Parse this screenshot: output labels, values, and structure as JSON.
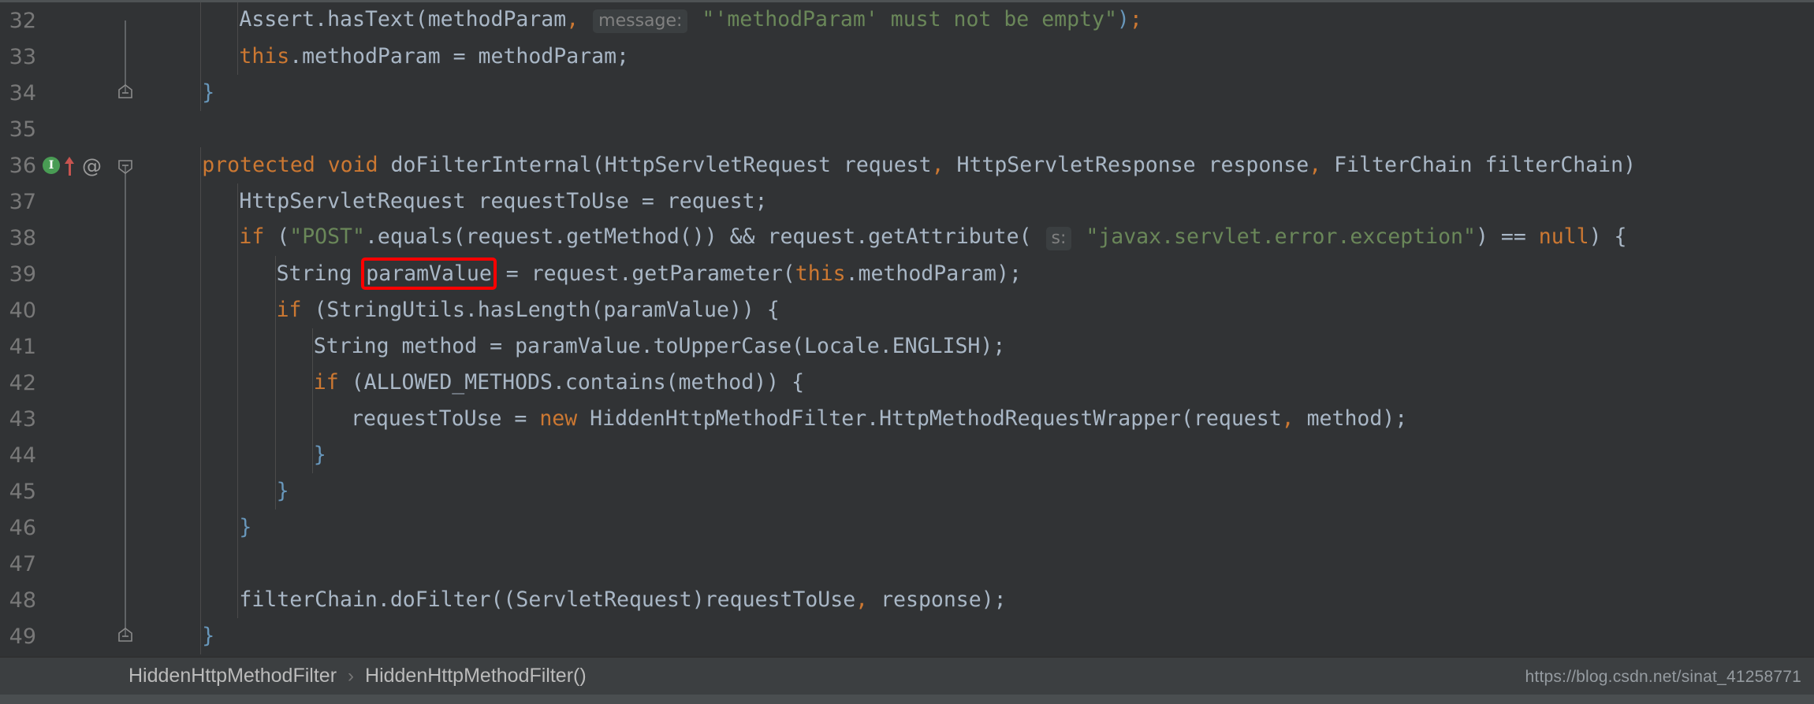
{
  "window": {
    "app": "IntelliJ IDEA",
    "theme": "Darcula"
  },
  "colors": {
    "editor_bg": "#313335",
    "gutter_bg": "#313335",
    "line_number": "#787878",
    "default_text": "#a9b7c6",
    "keyword": "#cc7832",
    "string": "#6a8759",
    "number": "#6897bb",
    "hint_bg": "#3b3f41",
    "hint_text": "#808080",
    "annotation_box": "#ff0000",
    "implements_marker": "#499c54",
    "override_arrow": "#c75450",
    "breadcrumb_bg": "#3c3f41",
    "breadcrumb_text": "#bbbbbb"
  },
  "gutter": {
    "markers": {
      "implements_icon_label": "I",
      "override_icon": "override-arrow-icon",
      "annotation_icon": "@"
    }
  },
  "code": {
    "language": "java",
    "lines": [
      {
        "number": "32",
        "indent": 2,
        "tokens": [
          {
            "text": "Assert",
            "cls": "t-txt"
          },
          {
            "text": ".hasText(",
            "cls": "t-txt"
          },
          {
            "text": "methodParam",
            "cls": "t-txt"
          },
          {
            "text": ",",
            "cls": "t-punc"
          },
          {
            "text": " ",
            "cls": "t-txt"
          },
          {
            "text": "message:",
            "cls": "phint"
          },
          {
            "text": " ",
            "cls": "t-txt"
          },
          {
            "text": "\"'methodParam' must not be empty\"",
            "cls": "t-str"
          },
          {
            "text": ")",
            "cls": "t-num"
          },
          {
            "text": ";",
            "cls": "t-punc"
          }
        ]
      },
      {
        "number": "33",
        "indent": 2,
        "tokens": [
          {
            "text": "this",
            "cls": "t-kw"
          },
          {
            "text": ".methodParam = methodParam;",
            "cls": "t-txt"
          }
        ]
      },
      {
        "number": "34",
        "indent": 1,
        "fold": "end",
        "tokens": [
          {
            "text": "}",
            "cls": "t-num"
          }
        ]
      },
      {
        "number": "35",
        "indent": 0,
        "tokens": []
      },
      {
        "number": "36",
        "indent": 1,
        "fold": "start",
        "markers": [
          "implements",
          "override",
          "annotation"
        ],
        "tokens": [
          {
            "text": "protected void ",
            "cls": "t-kw"
          },
          {
            "text": "doFilterInternal(HttpServletRequest request",
            "cls": "t-txt"
          },
          {
            "text": ",",
            "cls": "t-punc"
          },
          {
            "text": " HttpServletResponse response",
            "cls": "t-txt"
          },
          {
            "text": ",",
            "cls": "t-punc"
          },
          {
            "text": " FilterChain filterChain)",
            "cls": "t-txt"
          }
        ]
      },
      {
        "number": "37",
        "indent": 2,
        "tokens": [
          {
            "text": "HttpServletRequest requestToUse = request;",
            "cls": "t-txt"
          }
        ]
      },
      {
        "number": "38",
        "indent": 2,
        "fold": "start",
        "tokens": [
          {
            "text": "if",
            "cls": "t-kw"
          },
          {
            "text": " (",
            "cls": "t-txt"
          },
          {
            "text": "\"POST\"",
            "cls": "t-str"
          },
          {
            "text": ".equals(request.getMethod()) && request.getAttribute( ",
            "cls": "t-txt"
          },
          {
            "text": "s:",
            "cls": "phint"
          },
          {
            "text": " ",
            "cls": "t-txt"
          },
          {
            "text": "\"javax.servlet.error.exception\"",
            "cls": "t-str"
          },
          {
            "text": ") == ",
            "cls": "t-txt"
          },
          {
            "text": "null",
            "cls": "t-kw"
          },
          {
            "text": ") {",
            "cls": "t-txt"
          }
        ]
      },
      {
        "number": "39",
        "indent": 3,
        "tokens": [
          {
            "text": "String ",
            "cls": "t-txt"
          },
          {
            "text": "paramValue",
            "cls": "t-txt",
            "box": true
          },
          {
            "text": " = request.getParameter(",
            "cls": "t-txt"
          },
          {
            "text": "this",
            "cls": "t-kw"
          },
          {
            "text": ".methodParam);",
            "cls": "t-txt"
          }
        ]
      },
      {
        "number": "40",
        "indent": 3,
        "fold": "start",
        "tokens": [
          {
            "text": "if",
            "cls": "t-kw"
          },
          {
            "text": " (StringUtils.hasLength(paramValue)) {",
            "cls": "t-txt"
          }
        ]
      },
      {
        "number": "41",
        "indent": 4,
        "tokens": [
          {
            "text": "String method = paramValue.toUpperCase(Locale.ENGLISH);",
            "cls": "t-txt"
          }
        ]
      },
      {
        "number": "42",
        "indent": 4,
        "fold": "start",
        "tokens": [
          {
            "text": "if",
            "cls": "t-kw"
          },
          {
            "text": " (ALLOWED_METHODS.contains(method)) {",
            "cls": "t-txt"
          }
        ]
      },
      {
        "number": "43",
        "indent": 5,
        "tokens": [
          {
            "text": "requestToUse = ",
            "cls": "t-txt"
          },
          {
            "text": "new",
            "cls": "t-kw"
          },
          {
            "text": " HiddenHttpMethodFilter.HttpMethodRequestWrapper(request",
            "cls": "t-txt"
          },
          {
            "text": ",",
            "cls": "t-punc"
          },
          {
            "text": " method);",
            "cls": "t-txt"
          }
        ]
      },
      {
        "number": "44",
        "indent": 4,
        "fold": "end",
        "tokens": [
          {
            "text": "}",
            "cls": "t-num"
          }
        ]
      },
      {
        "number": "45",
        "indent": 3,
        "fold": "end",
        "tokens": [
          {
            "text": "}",
            "cls": "t-num"
          }
        ]
      },
      {
        "number": "46",
        "indent": 2,
        "fold": "end",
        "tokens": [
          {
            "text": "}",
            "cls": "t-num"
          }
        ]
      },
      {
        "number": "47",
        "indent": 0,
        "tokens": []
      },
      {
        "number": "48",
        "indent": 2,
        "tokens": [
          {
            "text": "filterChain.doFilter((ServletRequest)requestToUse",
            "cls": "t-txt"
          },
          {
            "text": ",",
            "cls": "t-punc"
          },
          {
            "text": " response);",
            "cls": "t-txt"
          }
        ]
      },
      {
        "number": "49",
        "indent": 1,
        "fold": "end",
        "tokens": [
          {
            "text": "}",
            "cls": "t-num"
          }
        ]
      }
    ]
  },
  "breadcrumb": {
    "separator": "›",
    "items": [
      {
        "label": "HiddenHttpMethodFilter"
      },
      {
        "label": "HiddenHttpMethodFilter()"
      }
    ]
  },
  "watermark": {
    "text": "https://blog.csdn.net/sinat_41258771"
  }
}
